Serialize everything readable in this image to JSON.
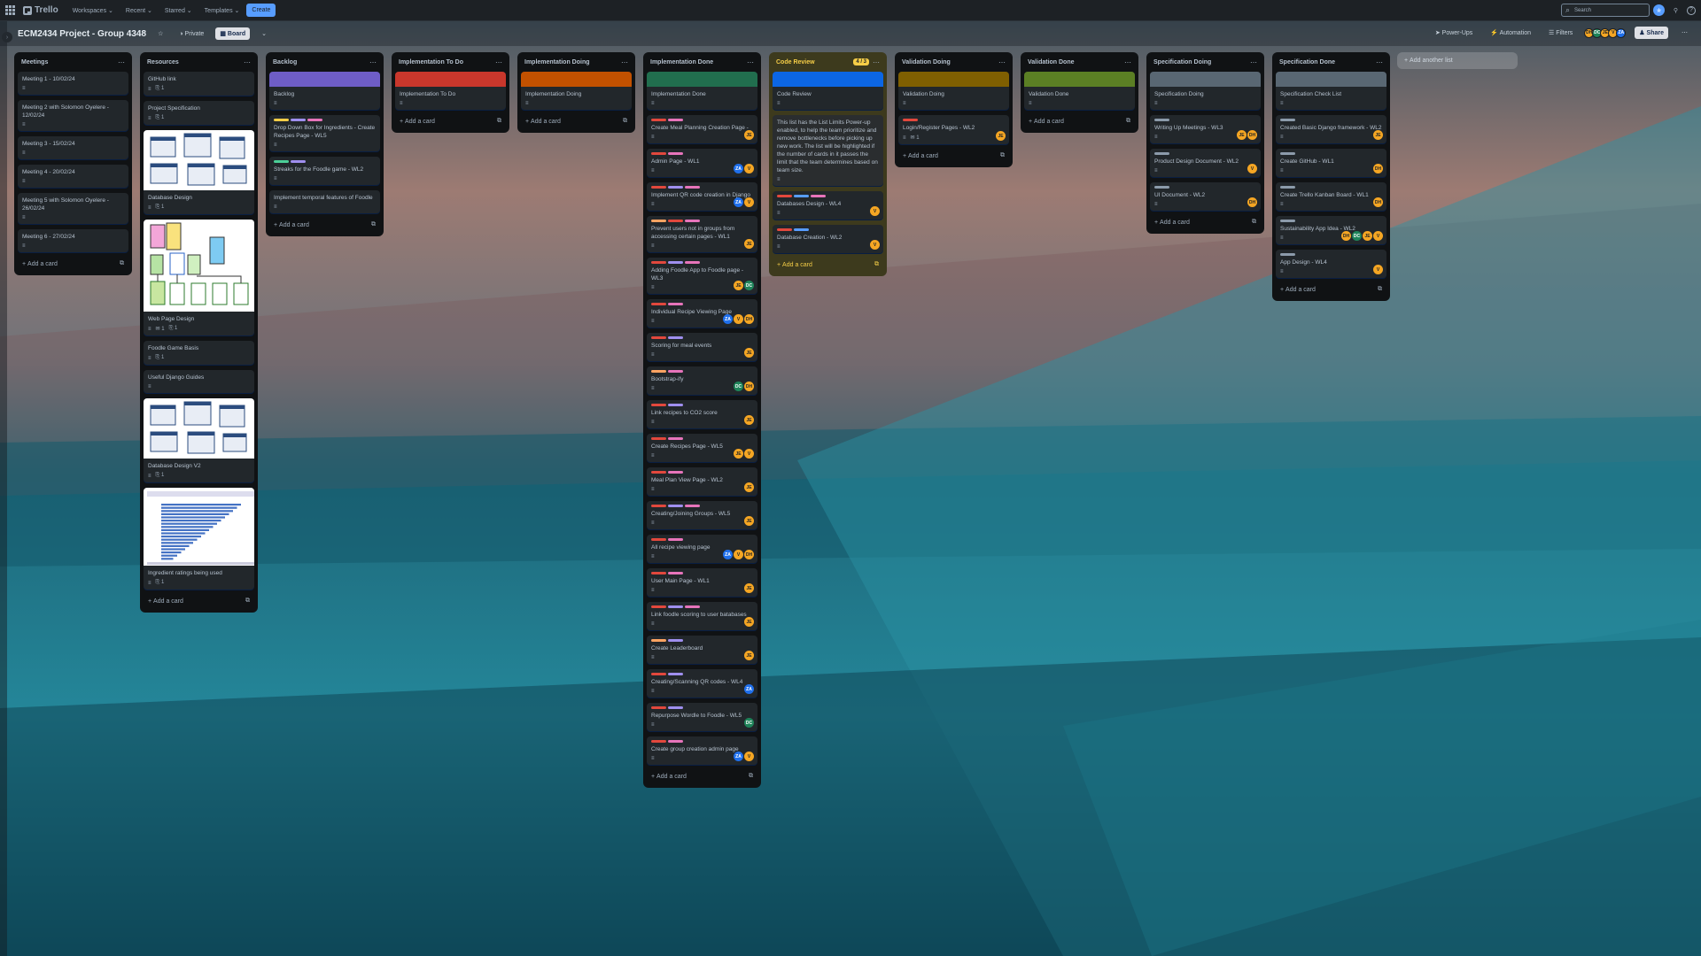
{
  "app": {
    "name": "Trello"
  },
  "topnav": {
    "menus": [
      "Workspaces",
      "Recent",
      "Starred",
      "Templates"
    ],
    "create": "Create",
    "search_placeholder": "Search"
  },
  "board": {
    "title": "ECM2434 Project - Group 4348",
    "visibility": "Private",
    "view": "Board",
    "power_ups": "Power-Ups",
    "automation": "Automation",
    "filters": "Filters",
    "share": "Share",
    "members": [
      "DH",
      "DC",
      "JE",
      "V",
      "ZA"
    ]
  },
  "add_list": "Add another list",
  "add_card": "Add a card",
  "colors": {
    "red": "#e2483d",
    "purple": "#9f8fef",
    "magenta": "#e774bb",
    "orange": "#fea362",
    "yellow": "#f5cd47",
    "green": "#4bce97",
    "blue": "#579dff",
    "grey": "#8c9bab",
    "avatar_orange": "#f5a623",
    "avatar_blue": "#1f6feb",
    "avatar_green": "#1f845a"
  },
  "lists": [
    {
      "name": "Meetings",
      "cards": [
        {
          "title": "Meeting 1 - 10/02/24"
        },
        {
          "title": "Meeting 2 with Solomon Oyelere - 12/02/24"
        },
        {
          "title": "Meeting 3 - 15/02/24"
        },
        {
          "title": "Meeting 4 - 20/02/24"
        },
        {
          "title": "Meeting 5 with Solomon Oyelere - 26/02/24"
        },
        {
          "title": "Meeting 6 - 27/02/24"
        }
      ]
    },
    {
      "name": "Resources",
      "cards": [
        {
          "title": "GitHub link",
          "attach": "1"
        },
        {
          "title": "Project Specification",
          "attach": "1"
        },
        {
          "title": "Database Design",
          "attach": "1"
        },
        {
          "title": "Web Page Design",
          "comments": "1",
          "attach": "1"
        },
        {
          "title": "Foodle Game Basis",
          "attach": "1"
        },
        {
          "title": "Useful Django Guides"
        },
        {
          "title": "Database Design V2",
          "attach": "1"
        },
        {
          "title": "Ingredient ratings being used",
          "attach": "1"
        }
      ]
    },
    {
      "name": "Backlog",
      "cards": [
        {
          "title": "Backlog"
        },
        {
          "title": "Drop Down Box for Ingredients - Create Recipes Page - WL5"
        },
        {
          "title": "Streaks for the Foodle game - WL2"
        },
        {
          "title": "Implement temporal features of Foodle"
        }
      ]
    },
    {
      "name": "Implementation To Do",
      "cards": [
        {
          "title": "Implementation To Do"
        }
      ]
    },
    {
      "name": "Implementation Doing",
      "cards": [
        {
          "title": "Implementation Doing"
        }
      ]
    },
    {
      "name": "Implementation Done",
      "cards": [
        {
          "title": "Implementation Done"
        },
        {
          "title": "Create Meal Planning Creation Page -",
          "members": [
            "JE"
          ]
        },
        {
          "title": "Admin Page - WL1",
          "members": [
            "ZA",
            "V"
          ]
        },
        {
          "title": "Implement QR code creation in Django",
          "members": [
            "ZA",
            "V"
          ]
        },
        {
          "title": "Prevent users not in groups from accessing certain pages - WL1",
          "members": [
            "JE"
          ]
        },
        {
          "title": "Adding Foodle App to Foodle page - WL3",
          "members": [
            "JE",
            "DC"
          ]
        },
        {
          "title": "Individual Recipe Viewing Page",
          "members": [
            "ZA",
            "V",
            "DH"
          ]
        },
        {
          "title": "Scoring for meal events",
          "members": [
            "JE"
          ]
        },
        {
          "title": "Bootstrap-ify",
          "members": [
            "DC",
            "DH"
          ]
        },
        {
          "title": "Link recipes to CO2 score",
          "members": [
            "JE"
          ]
        },
        {
          "title": "Create Recipes Page - WL5",
          "members": [
            "JE",
            "V"
          ]
        },
        {
          "title": "Meal Plan View Page - WL2",
          "members": [
            "JE"
          ]
        },
        {
          "title": "Creating/Joining Groups - WL5",
          "members": [
            "JE"
          ]
        },
        {
          "title": "All recipe viewing page",
          "members": [
            "ZA",
            "V",
            "DH"
          ]
        },
        {
          "title": "User Main Page - WL1",
          "members": [
            "JE"
          ]
        },
        {
          "title": "Link foodle scoring to user batabases",
          "members": [
            "JE"
          ]
        },
        {
          "title": "Create Leaderboard",
          "members": [
            "JE"
          ]
        },
        {
          "title": "Creating/Scanning QR codes - WL4",
          "members": [
            "ZA"
          ]
        },
        {
          "title": "Repurpose Wordle to Foodle - WL5",
          "members": [
            "DC"
          ]
        },
        {
          "title": "Create group creation admin page",
          "members": [
            "ZA",
            "V"
          ]
        }
      ]
    },
    {
      "name": "Code Review",
      "wip": "4 / 3",
      "cards": [
        {
          "title": "Code Review"
        },
        {
          "title": "This list has the List Limits Power-up enabled, to help the team prioritize and remove bottlenecks before picking up new work. The list will be highlighted if the number of cards in it passes the limit that the team determines based on team size."
        },
        {
          "title": "Databases Design - WL4",
          "members": [
            "V"
          ]
        },
        {
          "title": "Database Creation - WL2",
          "members": [
            "V"
          ]
        }
      ]
    },
    {
      "name": "Validation Doing",
      "cards": [
        {
          "title": "Validation Doing"
        },
        {
          "title": "Login/Register Pages - WL2",
          "comments": "1",
          "members": [
            "JE"
          ]
        }
      ]
    },
    {
      "name": "Validation Done",
      "cards": [
        {
          "title": "Validation Done"
        }
      ]
    },
    {
      "name": "Specification Doing",
      "cards": [
        {
          "title": "Specification Doing"
        },
        {
          "title": "Writing Up Meetings - WL3",
          "members": [
            "JE",
            "DH"
          ]
        },
        {
          "title": "Product Design Document - WL2",
          "members": [
            "V"
          ]
        },
        {
          "title": "UI Document - WL2",
          "members": [
            "DH"
          ]
        }
      ]
    },
    {
      "name": "Specification Done",
      "cards": [
        {
          "title": "Specification Check List"
        },
        {
          "title": "Created Basic Django framework - WL2",
          "members": [
            "JE"
          ]
        },
        {
          "title": "Create GitHub - WL1",
          "members": [
            "DH"
          ]
        },
        {
          "title": "Create Trello Kanban Board - WL1",
          "members": [
            "DH"
          ]
        },
        {
          "title": "Sustainability App Idea - WL2",
          "members": [
            "DH",
            "DC",
            "JE",
            "V"
          ]
        },
        {
          "title": "App Design - WL4",
          "members": [
            "V"
          ]
        }
      ]
    }
  ]
}
